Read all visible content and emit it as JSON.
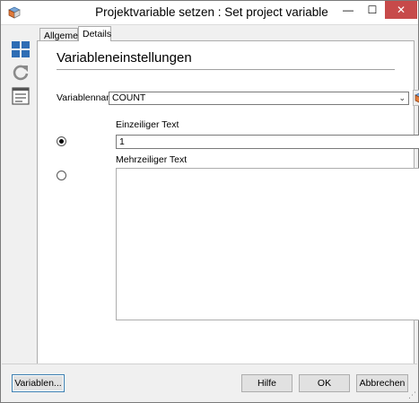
{
  "window": {
    "title": "Projektvariable setzen : Set project variable",
    "min_glyph": "—",
    "max_glyph": "☐",
    "close_glyph": "✕"
  },
  "toolbar": {
    "icons": [
      "layout-grid-icon",
      "refresh-icon",
      "list-panel-icon"
    ]
  },
  "tabs": [
    {
      "label": "Allgemein",
      "active": false
    },
    {
      "label": "Details",
      "active": true
    }
  ],
  "section": {
    "title": "Variableneinstellungen"
  },
  "variable": {
    "label": "Variablenname",
    "value": "COUNT",
    "arrow": "⌄"
  },
  "single_line": {
    "label": "Einzeiliger Text",
    "value": "1",
    "selected": true
  },
  "multi_line": {
    "label": "Mehrzeiliger Text",
    "value": "",
    "selected": false
  },
  "buttons": {
    "variables": "Variablen...",
    "help": "Hilfe",
    "ok": "OK",
    "cancel": "Abbrechen"
  },
  "colors": {
    "accent": "#3c7fb1",
    "close": "#c74a4a",
    "icon_blue": "#2e6db4",
    "icon_gray": "#8a8a8a"
  }
}
